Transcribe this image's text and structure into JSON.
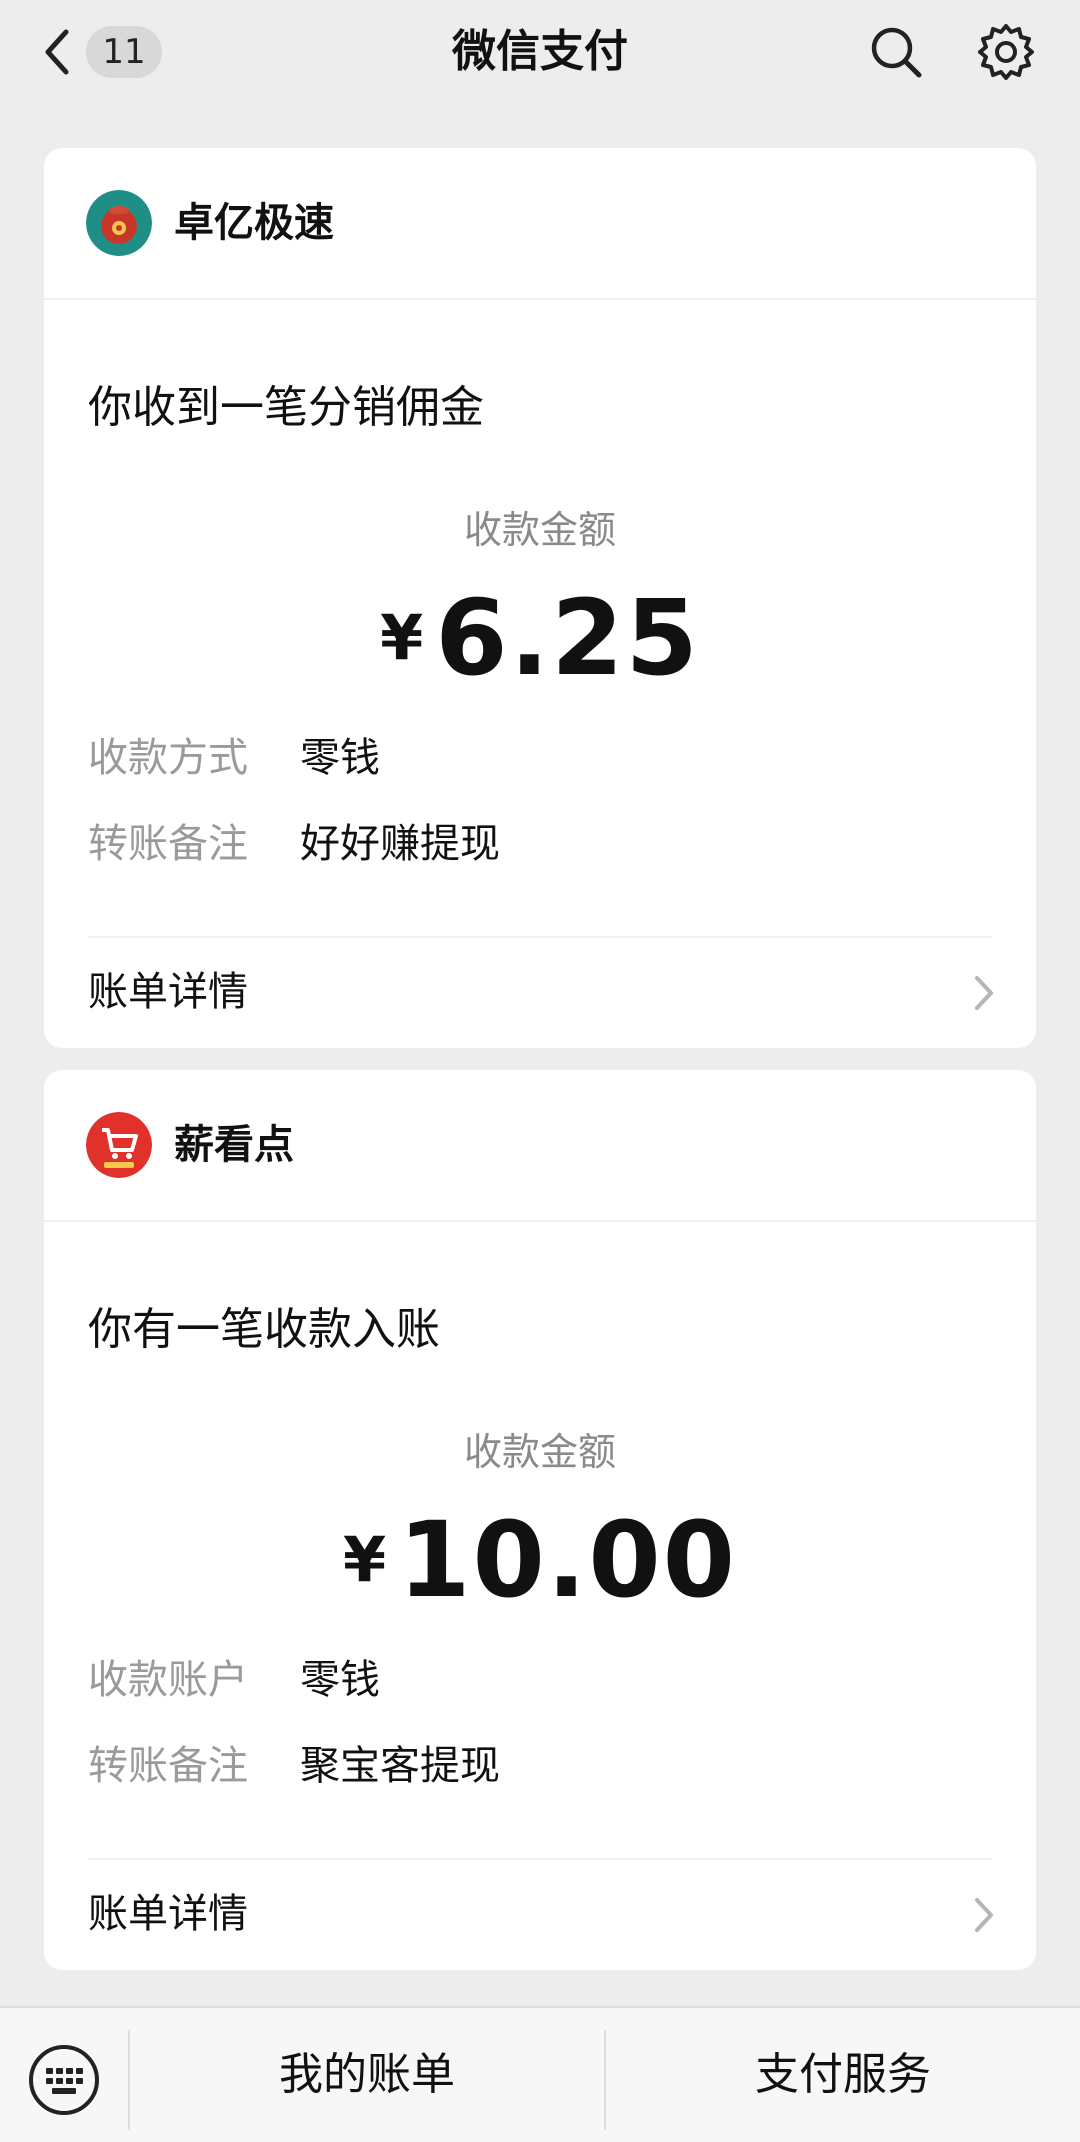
{
  "header": {
    "back_badge": "11",
    "title": "微信支付"
  },
  "cards": [
    {
      "app_name": "卓亿极速",
      "message": "你收到一笔分销佣金",
      "amount_label": "收款金额",
      "currency": "¥",
      "amount": "6.25",
      "fields": [
        {
          "label": "收款方式",
          "value": "零钱"
        },
        {
          "label": "转账备注",
          "value": "好好赚提现"
        }
      ],
      "detail_label": "账单详情"
    },
    {
      "app_name": "薪看点",
      "message": "你有一笔收款入账",
      "amount_label": "收款金额",
      "currency": "¥",
      "amount": "10.00",
      "fields": [
        {
          "label": "收款账户",
          "value": "零钱"
        },
        {
          "label": "转账备注",
          "value": "聚宝客提现"
        }
      ],
      "detail_label": "账单详情"
    }
  ],
  "bottom_bar": {
    "left_icon": "keyboard-icon",
    "buttons": [
      "我的账单",
      "支付服务"
    ]
  },
  "icons": {
    "back": "chevron-left-icon",
    "search": "search-icon",
    "settings": "gear-icon",
    "detail_arrow": "chevron-right-icon"
  }
}
